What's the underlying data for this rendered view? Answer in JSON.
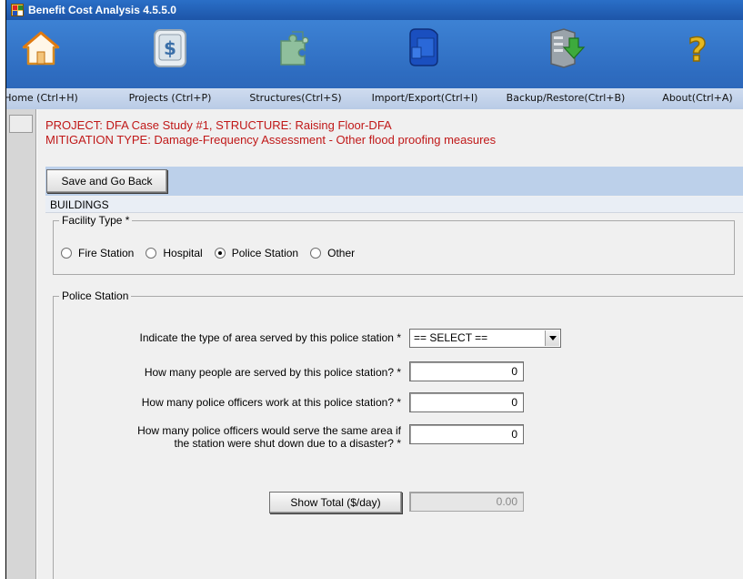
{
  "window": {
    "title": "Benefit Cost Analysis 4.5.5.0"
  },
  "toolbar": {
    "items": [
      {
        "label": "Home (Ctrl+H)",
        "icon": "home-icon"
      },
      {
        "label": "Projects (Ctrl+P)",
        "icon": "projects-icon"
      },
      {
        "label": "Structures(Ctrl+S)",
        "icon": "structures-icon"
      },
      {
        "label": "Import/Export(Ctrl+I)",
        "icon": "import-export-icon"
      },
      {
        "label": "Backup/Restore(Ctrl+B)",
        "icon": "backup-restore-icon"
      },
      {
        "label": "About(Ctrl+A)",
        "icon": "about-icon"
      }
    ]
  },
  "header": {
    "project_line": "PROJECT: DFA Case Study #1, STRUCTURE: Raising Floor-DFA",
    "mitigation_line": "MITIGATION TYPE: Damage-Frequency Assessment - Other flood proofing measures"
  },
  "actions": {
    "save_back_label": "Save and Go Back"
  },
  "section": {
    "title": "BUILDINGS"
  },
  "facility_type": {
    "legend": "Facility Type *",
    "options": [
      "Fire Station",
      "Hospital",
      "Police Station",
      "Other"
    ],
    "selected": "Police Station"
  },
  "police_station": {
    "legend": "Police Station",
    "area_label": "Indicate the type of area served by this police station *",
    "area_value": "== SELECT ==",
    "people_label": "How many people are served by this police station? *",
    "people_value": "0",
    "officers_label": "How many police officers work at this police station? *",
    "officers_value": "0",
    "shutdown_label_line1": "How many police officers would serve the same area if",
    "shutdown_label_line2": "the station were shut down due to a disaster? *",
    "shutdown_value": "0",
    "show_total_label": "Show Total ($/day)",
    "total_value": "0.00"
  },
  "colors": {
    "titlebar": "#1d55a8",
    "toolbar": "#2e6cc0",
    "header_text": "#c01818",
    "action_bar": "#bcd0ea"
  }
}
